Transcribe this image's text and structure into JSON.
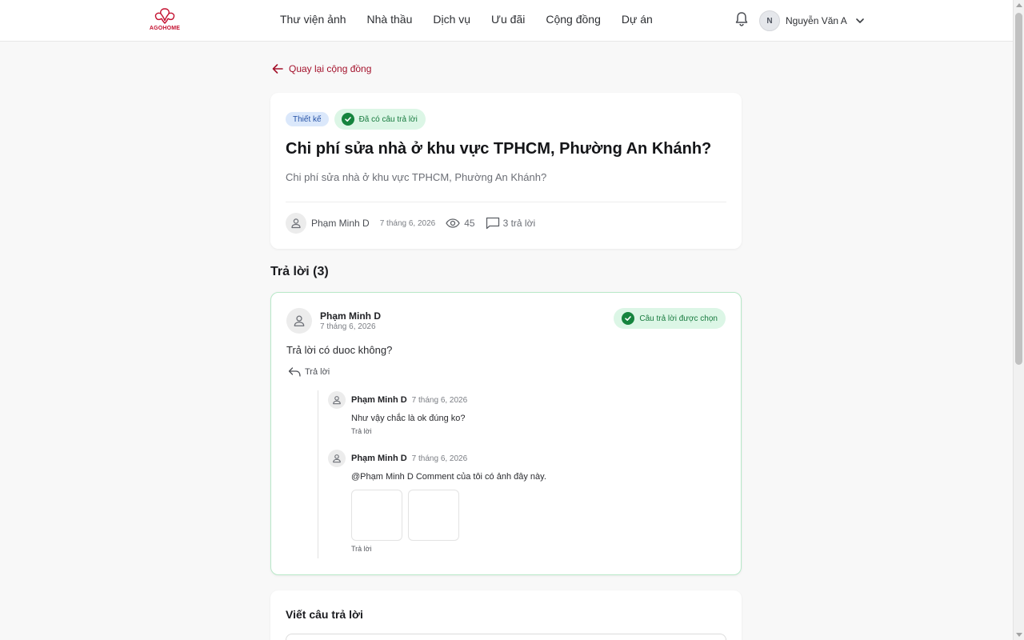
{
  "header": {
    "logo_text": "AGOHOME",
    "nav": [
      "Thư viện ảnh",
      "Nhà thầu",
      "Dịch vụ",
      "Ưu đãi",
      "Cộng đồng",
      "Dự án"
    ],
    "user_initial": "N",
    "user_name": "Nguyễn Văn A"
  },
  "back_link": "Quay lại cộng đồng",
  "question": {
    "tag_category": "Thiết kế",
    "tag_status": "Đã có câu trả lời",
    "title": "Chi phí sửa nhà ở khu vực TPHCM, Phường An Khánh?",
    "description": "Chi phí sửa nhà ở khu vực TPHCM, Phường An Khánh?",
    "author": "Phạm Minh D",
    "date": "7 tháng 6, 2026",
    "views": "45",
    "reply_count": "3 trả lời"
  },
  "replies_heading": "Trả lời (3)",
  "answer": {
    "author": "Phạm Minh D",
    "date": "7 tháng 6, 2026",
    "chosen_label": "Câu trả lời được chọn",
    "body": "Trả lời có duoc không?",
    "reply_label": "Trả lời",
    "sub_replies": [
      {
        "author": "Phạm Minh D",
        "date": "7 tháng 6, 2026",
        "text": "Như vậy chắc là ok đúng ko?",
        "reply_label": "Trả lời"
      },
      {
        "author": "Phạm Minh D",
        "date": "7 tháng 6, 2026",
        "text": "@Phạm Minh D Comment của tôi có ảnh đây này.",
        "reply_label": "Trả lời"
      }
    ]
  },
  "write_answer": {
    "title": "Viết câu trả lời"
  },
  "colors": {
    "brand": "#a4122c",
    "success": "#16843e",
    "success_bg": "#dcf6e6",
    "tag_blue_bg": "#dbe8fb"
  }
}
